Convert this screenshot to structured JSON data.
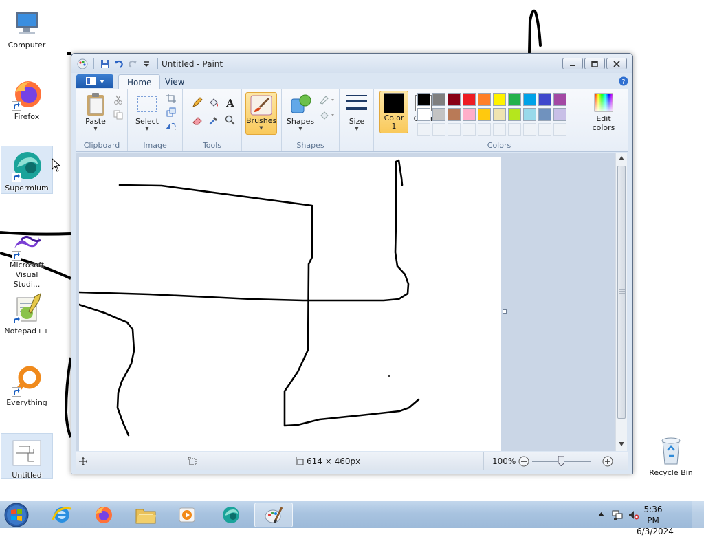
{
  "desktop": {
    "icons": [
      {
        "label": "Computer"
      },
      {
        "label": "Firefox"
      },
      {
        "label": "Supermium"
      },
      {
        "label_line1": "Microsoft",
        "label_line2": "Visual Studi..."
      },
      {
        "label": "Notepad++"
      },
      {
        "label": "Everything"
      },
      {
        "label": "Untitled"
      },
      {
        "label": "Recycle Bin"
      }
    ]
  },
  "window": {
    "title": "Untitled - Paint",
    "tabs": [
      "Home",
      "View"
    ],
    "groups": {
      "clipboard": "Clipboard",
      "image": "Image",
      "tools": "Tools",
      "shapes": "Shapes",
      "colors": "Colors"
    },
    "buttons": {
      "paste": "Paste",
      "select": "Select",
      "brushes": "Brushes",
      "shapes": "Shapes",
      "size": "Size",
      "color1_line1": "Color",
      "color1_line2": "1",
      "color2_line1": "Color",
      "color2_line2": "2",
      "edit_colors_line1": "Edit",
      "edit_colors_line2": "colors"
    },
    "color1": "#000000",
    "color2": "#ffffff",
    "palette_row1": [
      "#000000",
      "#7f7f7f",
      "#880015",
      "#ed1c24",
      "#ff7f27",
      "#fff200",
      "#22b14c",
      "#00a2e8",
      "#3f48cc",
      "#a349a4"
    ],
    "palette_row2": [
      "#ffffff",
      "#c3c3c3",
      "#b97a57",
      "#ffaec9",
      "#ffc90e",
      "#efe4b0",
      "#b5e61d",
      "#99d9ea",
      "#7092be",
      "#c8bfe7"
    ],
    "status": {
      "dimensions": "614 × 460px",
      "zoom": "100%"
    }
  },
  "taskbar": {
    "clock_time": "5:36 PM",
    "clock_date": "6/3/2024"
  }
}
